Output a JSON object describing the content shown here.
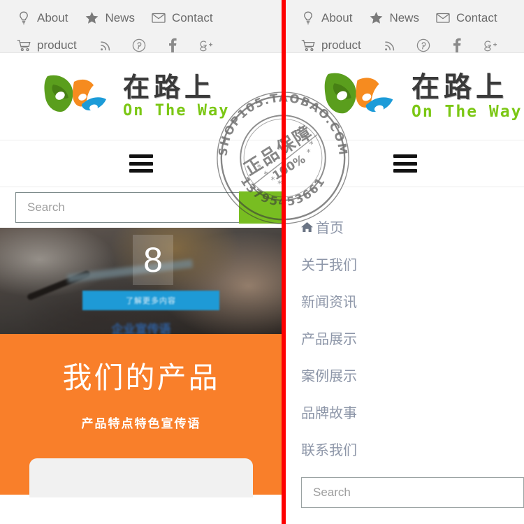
{
  "topbar": {
    "row1": [
      {
        "label": "About",
        "icon": "lightbulb-icon"
      },
      {
        "label": "News",
        "icon": "star-icon"
      },
      {
        "label": "Contact",
        "icon": "envelope-icon"
      }
    ],
    "row2": [
      {
        "label": "product",
        "icon": "cart-icon"
      }
    ],
    "social": [
      {
        "icon": "rss-icon",
        "label": "RSS"
      },
      {
        "icon": "pinterest-icon",
        "label": "Pinterest"
      },
      {
        "icon": "facebook-icon",
        "label": "Facebook"
      },
      {
        "icon": "google-plus-icon",
        "label": "Google Plus"
      }
    ],
    "background": "#f2f2f2"
  },
  "logo": {
    "chinese": "在路上",
    "english": "On The Way",
    "mark_colors": [
      "#5a9e1d",
      "#f68b1f",
      "#1c9bd8"
    ],
    "english_color": "#7bc714"
  },
  "menu": {
    "hamburger_label": "Menu"
  },
  "search": {
    "placeholder": "Search",
    "value": "",
    "button_color": "#78bd21",
    "button_label": ""
  },
  "hero": {
    "number": "8",
    "button_label": "了解更多内容",
    "caption": "企业宣传语"
  },
  "product": {
    "title": "我们的产品",
    "subtitle": "产品特点特色宣传语",
    "background": "#f97f2a"
  },
  "nav": {
    "items": [
      {
        "label": "首页",
        "icon": "home-icon"
      },
      {
        "label": "关于我们",
        "icon": ""
      },
      {
        "label": "新闻资讯",
        "icon": ""
      },
      {
        "label": "产品展示",
        "icon": ""
      },
      {
        "label": "案例展示",
        "icon": ""
      },
      {
        "label": "品牌故事",
        "icon": ""
      },
      {
        "label": "联系我们",
        "icon": ""
      }
    ]
  },
  "right_search": {
    "placeholder": "Search",
    "value": ""
  },
  "watermark": {
    "outer_text": "SHOP105.TAOBAO.COM",
    "bottom_text": "13795453661",
    "inner_text": "正品保障",
    "inner_sub": "100%"
  },
  "divider": {
    "color": "#fe0000"
  }
}
